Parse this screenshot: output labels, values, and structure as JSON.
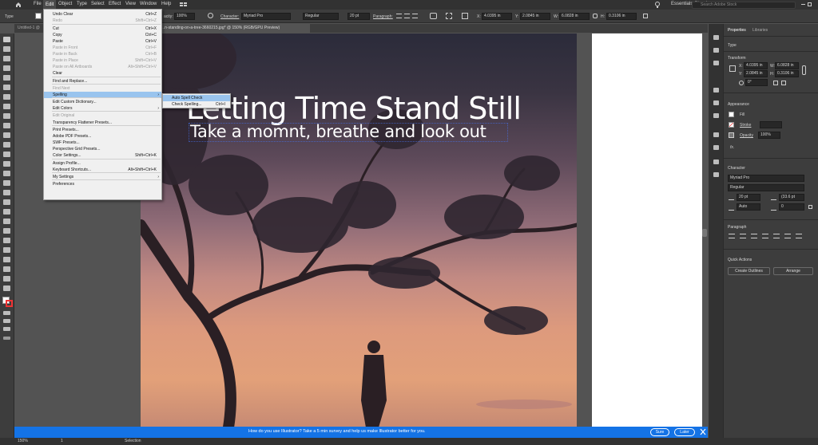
{
  "menubar": {
    "items": [
      "File",
      "Edit",
      "Object",
      "Type",
      "Select",
      "Effect",
      "View",
      "Window",
      "Help"
    ],
    "workspace": "Essentials Classic",
    "search_placeholder": "Search Adobe Stock"
  },
  "control_bar": {
    "tool_label": "Type",
    "opacity_label": "acity:",
    "opacity_value": "100%",
    "character_label": "Character:",
    "font_value": "Myriad Pro",
    "style_value": "Regular",
    "size_value": "20 pt",
    "paragraph_label": "Paragraph:",
    "x_label": "X:",
    "x_value": "4.0395 in",
    "y_label": "Y:",
    "y_value": "2.0845 in",
    "w_label": "W:",
    "w_value": "6.0828 in",
    "h_label": "H:",
    "h_value": "0.3106 in"
  },
  "tabs": {
    "doc1": "Untitled-1 @",
    "doc2": "...n-standing-on-a-tree-3660215.jpg* @ 150% (RGB/GPU Preview)"
  },
  "canvas": {
    "title": "Letting Time Stand Still",
    "subtitle": "Take a momnt, breathe and look out"
  },
  "edit_menu": {
    "items": [
      {
        "label": "Undo Clear",
        "shortcut": "Ctrl+Z",
        "disabled": false
      },
      {
        "label": "Redo",
        "shortcut": "Shift+Ctrl+Z",
        "disabled": true
      },
      {
        "label": "Cut",
        "shortcut": "Ctrl+X",
        "disabled": false
      },
      {
        "label": "Copy",
        "shortcut": "Ctrl+C",
        "disabled": false
      },
      {
        "label": "Paste",
        "shortcut": "Ctrl+V",
        "disabled": false
      },
      {
        "label": "Paste in Front",
        "shortcut": "Ctrl+F",
        "disabled": true
      },
      {
        "label": "Paste in Back",
        "shortcut": "Ctrl+B",
        "disabled": true
      },
      {
        "label": "Paste in Place",
        "shortcut": "Shift+Ctrl+V",
        "disabled": true
      },
      {
        "label": "Paste on All Artboards",
        "shortcut": "Alt+Shift+Ctrl+V",
        "disabled": true
      },
      {
        "label": "Clear",
        "shortcut": "",
        "disabled": false
      },
      {
        "label": "Find and Replace...",
        "shortcut": "",
        "disabled": false
      },
      {
        "label": "Find Next",
        "shortcut": "",
        "disabled": true
      },
      {
        "label": "Spelling",
        "shortcut": "",
        "disabled": false
      },
      {
        "label": "Edit Custom Dictionary...",
        "shortcut": "",
        "disabled": false
      },
      {
        "label": "Edit Colors",
        "shortcut": "",
        "disabled": false
      },
      {
        "label": "Edit Original",
        "shortcut": "",
        "disabled": true
      },
      {
        "label": "Transparency Flattener Presets...",
        "shortcut": "",
        "disabled": false
      },
      {
        "label": "Print Presets...",
        "shortcut": "",
        "disabled": false
      },
      {
        "label": "Adobe PDF Presets...",
        "shortcut": "",
        "disabled": false
      },
      {
        "label": "SWF Presets...",
        "shortcut": "",
        "disabled": false
      },
      {
        "label": "Perspective Grid Presets...",
        "shortcut": "",
        "disabled": false
      },
      {
        "label": "Color Settings...",
        "shortcut": "Shift+Ctrl+K",
        "disabled": false
      },
      {
        "label": "Assign Profile...",
        "shortcut": "",
        "disabled": false
      },
      {
        "label": "Keyboard Shortcuts...",
        "shortcut": "Alt+Shift+Ctrl+K",
        "disabled": false
      },
      {
        "label": "My Settings",
        "shortcut": "",
        "disabled": false
      },
      {
        "label": "Preferences",
        "shortcut": "",
        "disabled": false
      }
    ]
  },
  "spelling_submenu": {
    "items": [
      {
        "label": "Auto Spell Check",
        "shortcut": ""
      },
      {
        "label": "Check Spelling...",
        "shortcut": "Ctrl+I"
      }
    ]
  },
  "properties": {
    "tab_properties": "Properties",
    "tab_libraries": "Libraries",
    "object_type": "Type",
    "transform_heading": "Transform",
    "x_label": "X:",
    "x_value": "4.0395 in",
    "w_label": "W:",
    "w_value": "6.0828 in",
    "y_label": "Y:",
    "y_value": "2.0845 in",
    "h_label": "H:",
    "h_value": "0.3106 in",
    "rotate_value": "0°",
    "appearance_heading": "Appearance",
    "fill_label": "Fill",
    "stroke_label": "Stroke",
    "opacity_label": "Opacity",
    "opacity_value": "100%",
    "fx_label": "fx.",
    "character_heading": "Character",
    "font_value": "Myriad Pro",
    "style_value": "Regular",
    "size_value": "20 pt",
    "leading_value": "(33.6 pt",
    "tracking_value": "Auto",
    "kerning_value": "0",
    "paragraph_heading": "Paragraph",
    "quick_actions_heading": "Quick Actions",
    "create_outlines_label": "Create Outlines",
    "arrange_label": "Arrange"
  },
  "survey": {
    "message": "How do you use Illustrator? Take a 5 min survey and help us make Illustrator better for you.",
    "sure_label": "Sure",
    "later_label": "Later"
  },
  "status_bar": {
    "zoom": "150%",
    "artboard": "1",
    "tool": "Selection"
  },
  "colors": {
    "accent": "#1473e6",
    "menu_highlight": "#99c4ee",
    "panel_bg": "#3d3d3d",
    "canvas_bg": "#535353"
  }
}
